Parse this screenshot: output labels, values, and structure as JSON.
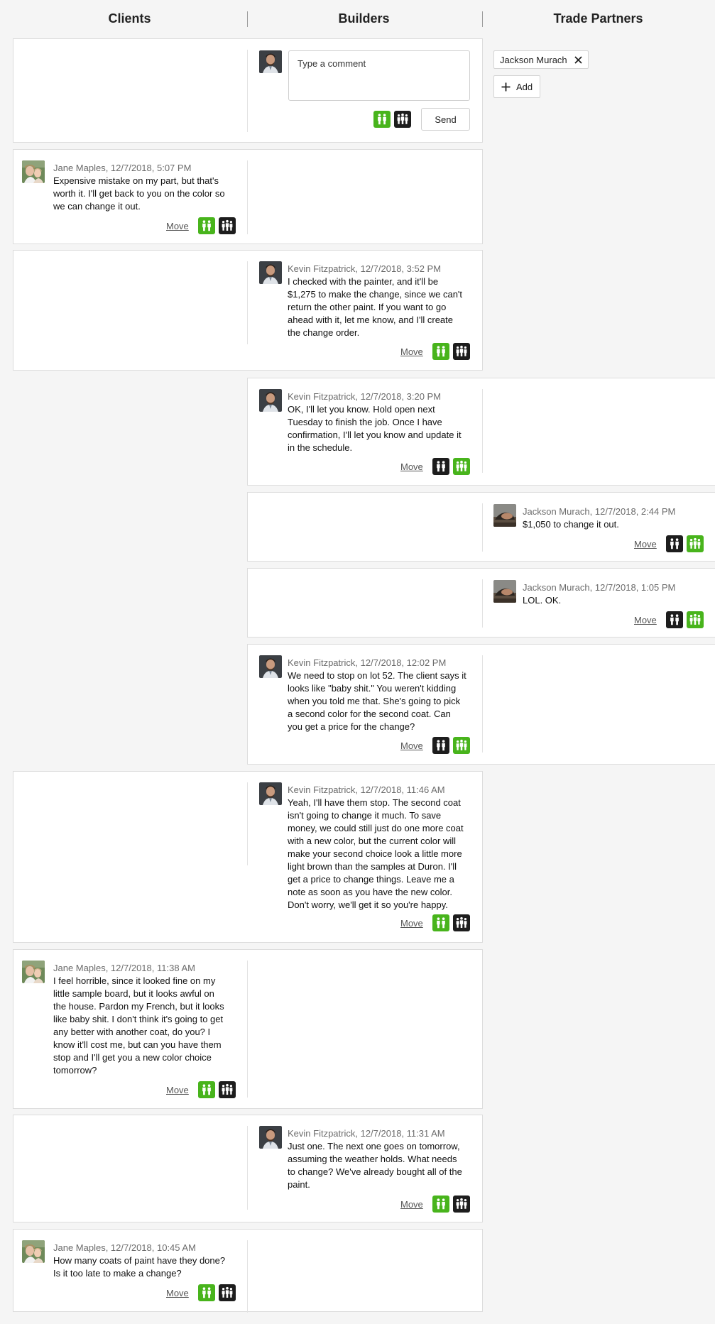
{
  "columns": {
    "clients": "Clients",
    "builders": "Builders",
    "trade_partners": "Trade Partners"
  },
  "compose": {
    "placeholder": "Type a comment",
    "send_label": "Send"
  },
  "trade_partners": {
    "chip_label": "Jackson Murach",
    "add_label": "Add"
  },
  "labels": {
    "move": "Move"
  },
  "colors": {
    "visible_green": "#48b41c",
    "hidden_black": "#1d1d1d"
  },
  "messages": [
    {
      "author": "Jane Maples, 12/7/2018, 5:07 PM",
      "text": [
        "Expensive mistake on my part, but that's",
        "worth it. I'll get back to you on the color so",
        "we can change it out."
      ]
    },
    {
      "author": "Kevin Fitzpatrick, 12/7/2018, 3:52 PM",
      "text": [
        "I checked with the painter, and it'll be",
        "$1,275 to make the change, since we can't",
        "return the other paint. If you want to go",
        "ahead with it, let me know, and I'll create",
        "the change order."
      ]
    },
    {
      "author": "Kevin Fitzpatrick, 12/7/2018, 3:20 PM",
      "text": [
        "OK, I'll let you know. Hold open next",
        "Tuesday to finish the job. Once I have",
        "confirmation, I'll let you know and update it",
        "in the schedule."
      ]
    },
    {
      "author": "Jackson Murach, 12/7/2018, 2:44 PM",
      "text": [
        "$1,050 to change it out."
      ]
    },
    {
      "author": "Jackson Murach, 12/7/2018, 1:05 PM",
      "text": [
        "LOL. OK."
      ]
    },
    {
      "author": "Kevin Fitzpatrick, 12/7/2018, 12:02 PM",
      "text": [
        "We need to stop on lot 52. The client says it",
        "looks like \"baby shit.\" You weren't kidding",
        "when you told me that. She's going to pick",
        "a second color for the second coat. Can",
        "you get a price for the change?"
      ]
    },
    {
      "author": "Kevin Fitzpatrick, 12/7/2018, 11:46 AM",
      "text": [
        "Yeah, I'll have them stop. The second coat",
        "isn't going to change it much. To save",
        "money, we could still just do one more coat",
        "with a new color, but the current color will",
        "make your second choice look a little more",
        "light brown than the samples at Duron. I'll",
        "get a price to change things. Leave me a",
        "note as soon as you have the new color.",
        "Don't worry, we'll get it so you're happy."
      ]
    },
    {
      "author": "Jane Maples, 12/7/2018, 11:38 AM",
      "text": [
        "I feel horrible, since it looked fine on my",
        "little sample board, but it looks awful on",
        "the house. Pardon my French, but it looks",
        "like baby shit. I don't think it's going to get",
        "any better with another coat, do you? I",
        "know it'll cost me, but can you have them",
        "stop and I'll get you a new color choice",
        "tomorrow?"
      ]
    },
    {
      "author": "Kevin Fitzpatrick, 12/7/2018, 11:31 AM",
      "text": [
        "Just one. The next one goes on tomorrow,",
        "assuming the weather holds. What needs",
        "to change? We've already bought all of the",
        "paint."
      ]
    },
    {
      "author": "Jane Maples, 12/7/2018, 10:45 AM",
      "text": [
        "How many coats of paint have they done?",
        "Is it too late to make a change?"
      ]
    }
  ]
}
